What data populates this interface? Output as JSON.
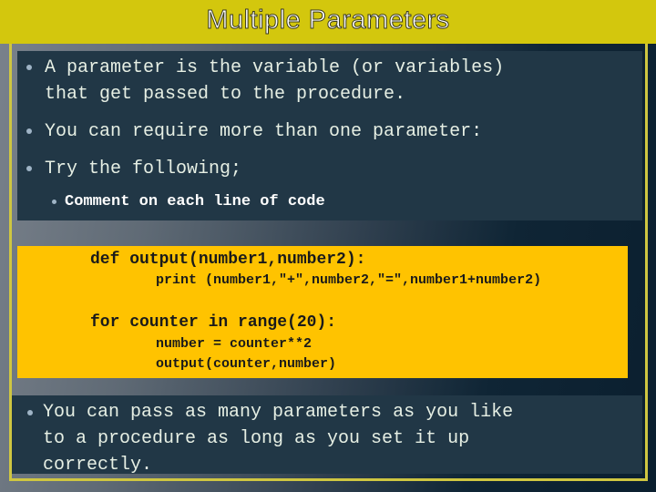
{
  "slide": {
    "title": "Multiple Parameters",
    "colors": {
      "title_bar": "#d3c70d",
      "frame": "#cfc641",
      "text_box": "#213746",
      "code_box": "#ffc300",
      "text": "#e6efe4"
    }
  },
  "top_box": {
    "bullets": [
      {
        "lines": [
          "A parameter is the variable (or variables)",
          "that get passed to the procedure."
        ]
      },
      {
        "lines": [
          "You can require more than one parameter:"
        ]
      },
      {
        "lines": [
          "Try the following;"
        ]
      }
    ],
    "sub_bullets": [
      "Comment on each line of code"
    ]
  },
  "code_block": {
    "lines": [
      "def output(number1,number2):",
      "print (number1,\"+\",number2,\"=\",number1+number2)",
      "for counter in range(20):",
      "number = counter**2",
      "output(counter,number)"
    ]
  },
  "bottom_box": {
    "bullets": [
      {
        "lines": [
          "You can pass as many parameters as you like",
          "to a procedure as long as you set it up",
          "correctly."
        ]
      }
    ]
  }
}
